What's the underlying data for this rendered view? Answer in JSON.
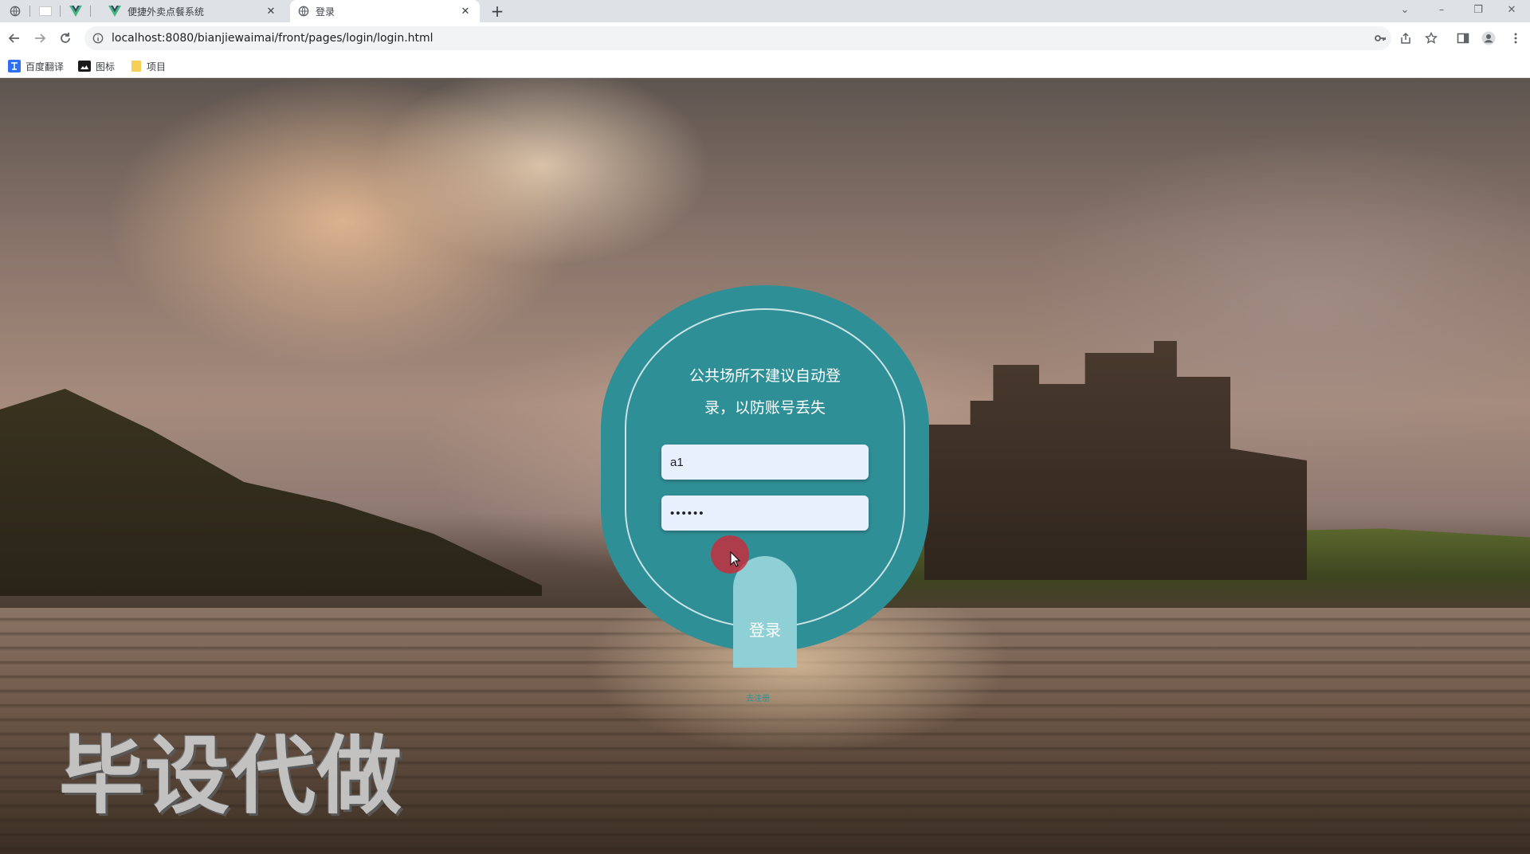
{
  "browser": {
    "tabs": [
      {
        "title": "便捷外卖点餐系统",
        "icon": "vue-logo-icon",
        "active": false
      },
      {
        "title": "登录",
        "icon": "globe-icon",
        "active": true
      }
    ],
    "url": "localhost:8080/bianjiewaimai/front/pages/login/login.html",
    "bookmarks": [
      {
        "label": "百度翻译",
        "icon": "translate-icon"
      },
      {
        "label": "图标",
        "icon": "image-icon"
      },
      {
        "label": "项目",
        "icon": "folder-icon"
      }
    ]
  },
  "login": {
    "tip_line1": "公共场所不建议自动登",
    "tip_line2": "录，以防账号丢失",
    "username_value": "a1",
    "password_value": "••••••",
    "button_label": "登录",
    "register_label": "去注册"
  },
  "watermark": "毕设代做",
  "colors": {
    "card": "#2f8f96",
    "button": "#8fcfd6",
    "input_bg": "#e8f0fe",
    "click_indicator": "#cd2837"
  }
}
